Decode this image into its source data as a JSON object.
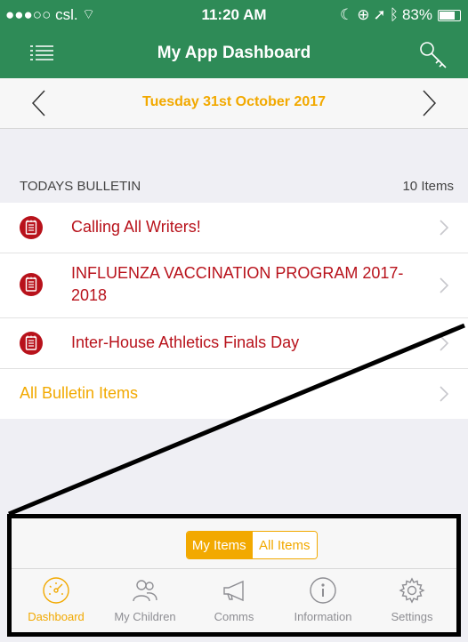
{
  "status_bar": {
    "carrier": "●●●○○ csl.",
    "time": "11:20 AM",
    "battery": "83%",
    "battery_level": 0.83
  },
  "nav": {
    "title": "My App Dashboard",
    "menu_icon": "list-menu-icon",
    "key_icon": "key-icon"
  },
  "date_bar": {
    "date": "Tuesday 31st October 2017"
  },
  "bulletin": {
    "title": "TODAYS BULLETIN",
    "count": "10 Items",
    "items": [
      {
        "label": "Calling All Writers!"
      },
      {
        "label": "INFLUENZA VACCINATION PROGRAM 2017-2018"
      },
      {
        "label": "Inter-House Athletics Finals Day"
      }
    ],
    "all_link": "All Bulletin Items"
  },
  "segment": {
    "my_items": "My Items",
    "all_items": "All Items",
    "selected": "My Items"
  },
  "tabs": [
    {
      "label": "Dashboard",
      "icon": "dashboard-gauge-icon",
      "active": true
    },
    {
      "label": "My Children",
      "icon": "people-icon",
      "active": false
    },
    {
      "label": "Comms",
      "icon": "megaphone-icon",
      "active": false
    },
    {
      "label": "Information",
      "icon": "info-icon",
      "active": false
    },
    {
      "label": "Settings",
      "icon": "gear-icon",
      "active": false
    }
  ],
  "colors": {
    "header_green": "#2e8b57",
    "accent_orange": "#f2a900",
    "bulletin_red": "#b8121b",
    "tab_gray": "#8e8e93"
  }
}
